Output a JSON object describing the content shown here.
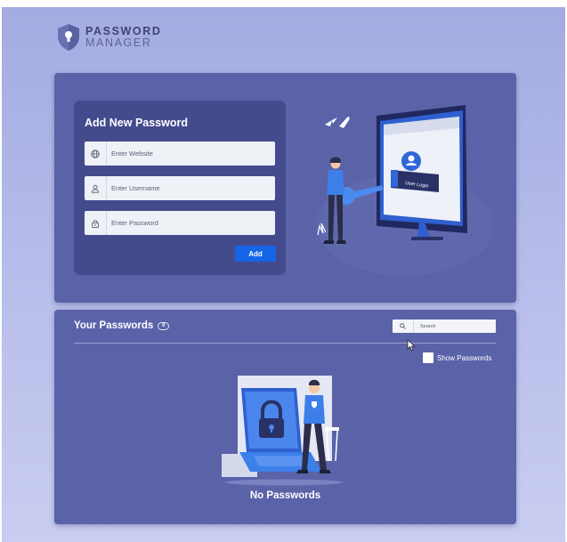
{
  "logo": {
    "line1": "PASSWORD",
    "line2": "MANAGER",
    "icon": "shield-keyhole-icon"
  },
  "add_form": {
    "title": "Add New Password",
    "website": {
      "placeholder": "Enter Website",
      "value": "",
      "icon": "globe-icon"
    },
    "username": {
      "placeholder": "Enter Username",
      "value": "",
      "icon": "user-icon"
    },
    "password": {
      "placeholder": "Enter Password",
      "value": "",
      "icon": "lock-icon"
    },
    "add_label": "Add"
  },
  "illustration_top": {
    "screen_text": "User Login"
  },
  "passwords": {
    "title": "Your Passwords",
    "count": "0",
    "search_placeholder": "Search",
    "search_icon": "search-icon",
    "show_passwords_label": "Show Passwords",
    "show_passwords_checked": false,
    "empty_text": "No Passwords"
  },
  "colors": {
    "background": "#a3abe2",
    "card": "#5a62a8",
    "form_panel": "#444b8c",
    "accent": "#1565e6"
  }
}
